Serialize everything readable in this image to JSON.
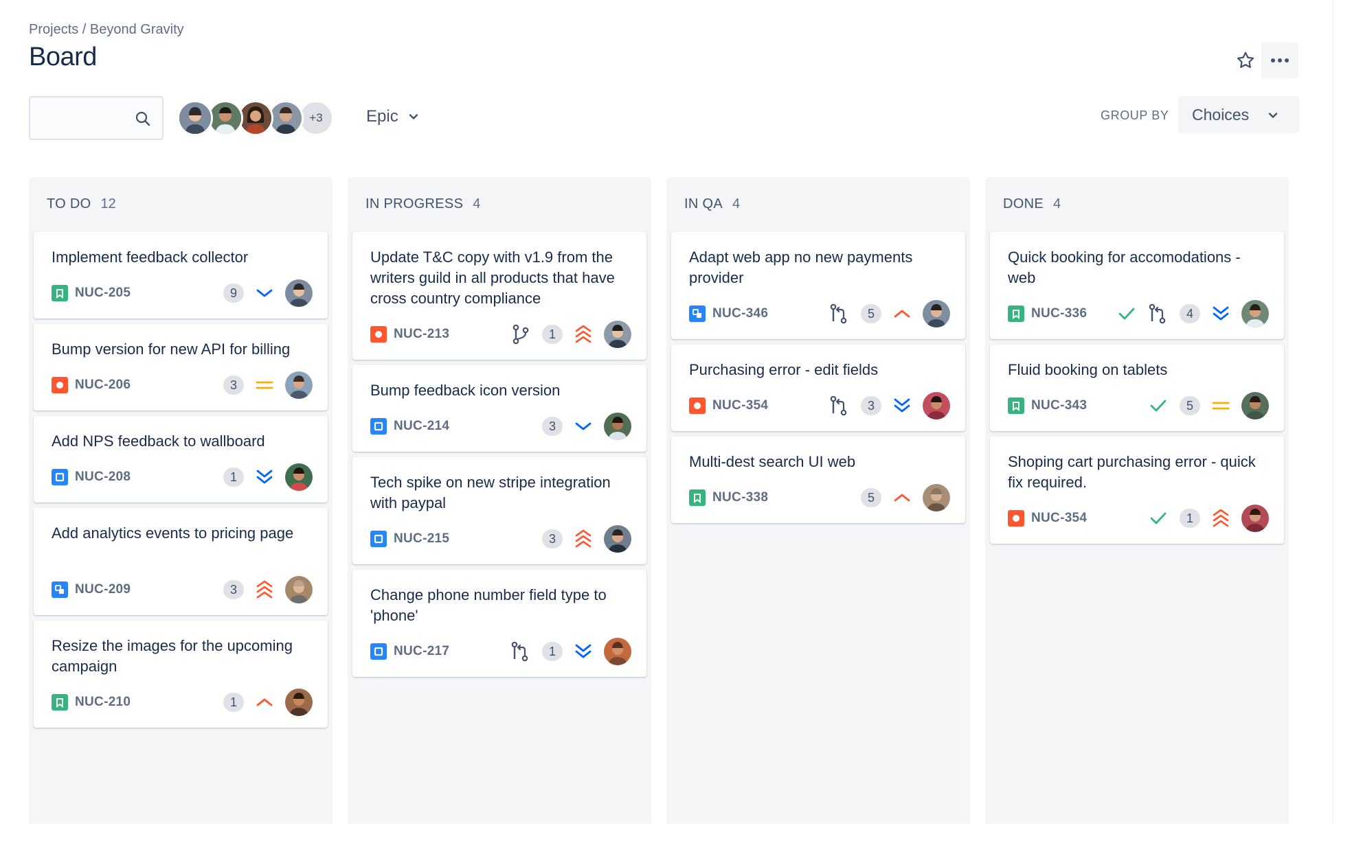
{
  "breadcrumb": "Projects / Beyond Gravity",
  "page_title": "Board",
  "search": {
    "value": "",
    "placeholder": ""
  },
  "avatars": {
    "more_label": "+3"
  },
  "epic_filter": {
    "label": "Epic"
  },
  "group_by": {
    "label": "GROUP BY",
    "value": "Choices"
  },
  "colors": {
    "story": "#36B37E",
    "bug": "#FF5630",
    "task": "#2684FF",
    "subtask": "#2684FF",
    "priority_high": "#FF5630",
    "priority_medium": "#FFAB00",
    "priority_low": "#0065FF",
    "done_check": "#36B37E"
  },
  "columns": [
    {
      "title": "TO DO",
      "count": "12",
      "cards": [
        {
          "title": "Implement feedback collector",
          "key": "NUC-205",
          "type": "story",
          "estimate": "9",
          "priority": "low",
          "avatar": "person-1"
        },
        {
          "title": "Bump version for new API for billing",
          "key": "NUC-206",
          "type": "bug",
          "estimate": "3",
          "priority": "medium",
          "avatar": "person-2"
        },
        {
          "title": "Add NPS feedback to wallboard",
          "key": "NUC-208",
          "type": "task",
          "estimate": "1",
          "priority": "lowest",
          "avatar": "person-3"
        },
        {
          "title": "Add analytics events to pricing page",
          "key": "NUC-209",
          "type": "subtask",
          "estimate": "3",
          "priority": "highest",
          "avatar": "person-4"
        },
        {
          "title": "Resize the images for the upcoming campaign",
          "key": "NUC-210",
          "type": "story",
          "estimate": "1",
          "priority": "high",
          "avatar": "person-5"
        }
      ]
    },
    {
      "title": "IN PROGRESS",
      "count": "4",
      "cards": [
        {
          "title": "Update T&C copy with v1.9 from the writers guild in all products that have cross country compliance",
          "key": "NUC-213",
          "type": "bug",
          "dev": "branch",
          "estimate": "1",
          "priority": "highest",
          "avatar": "person-6"
        },
        {
          "title": "Bump feedback icon version",
          "key": "NUC-214",
          "type": "task",
          "estimate": "3",
          "priority": "low",
          "avatar": "person-7"
        },
        {
          "title": "Tech spike on new stripe integration with paypal",
          "key": "NUC-215",
          "type": "task",
          "estimate": "3",
          "priority": "highest",
          "avatar": "person-8"
        },
        {
          "title": "Change phone number field type to 'phone'",
          "key": "NUC-217",
          "type": "task",
          "dev": "pull-request",
          "estimate": "1",
          "priority": "lowest",
          "avatar": "person-9"
        }
      ]
    },
    {
      "title": "IN QA",
      "count": "4",
      "cards": [
        {
          "title": "Adapt web app no new payments provider",
          "key": "NUC-346",
          "type": "subtask",
          "dev": "pull-request",
          "estimate": "5",
          "priority": "high",
          "avatar": "person-10"
        },
        {
          "title": "Purchasing error - edit fields",
          "key": "NUC-354",
          "type": "bug",
          "dev": "pull-request",
          "estimate": "3",
          "priority": "lowest",
          "avatar": "person-11"
        },
        {
          "title": "Multi-dest search UI web",
          "key": "NUC-338",
          "type": "story",
          "estimate": "5",
          "priority": "high",
          "avatar": "person-12"
        }
      ]
    },
    {
      "title": "DONE",
      "count": "4",
      "cards": [
        {
          "title": "Quick booking for accomodations - web",
          "key": "NUC-336",
          "type": "story",
          "done": true,
          "dev": "pull-request",
          "estimate": "4",
          "priority": "lowest",
          "avatar": "person-13"
        },
        {
          "title": "Fluid booking on tablets",
          "key": "NUC-343",
          "type": "story",
          "done": true,
          "estimate": "5",
          "priority": "medium",
          "avatar": "person-14"
        },
        {
          "title": "Shoping cart purchasing error - quick fix required.",
          "key": "NUC-354",
          "type": "bug",
          "done": true,
          "estimate": "1",
          "priority": "highest",
          "avatar": "person-15"
        }
      ]
    }
  ]
}
